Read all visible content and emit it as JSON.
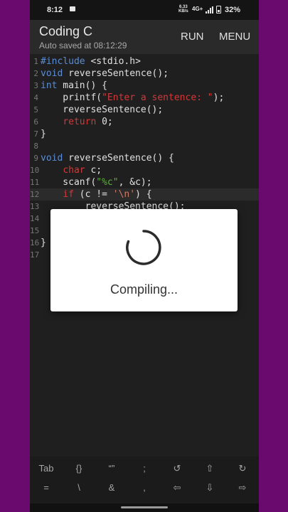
{
  "status_bar": {
    "time": "8:12",
    "speed_value": "6.33",
    "speed_unit": "KB/s",
    "network": "4G+",
    "battery": "32%"
  },
  "header": {
    "title": "Coding C",
    "autosave": "Auto saved at 08:12:29",
    "run_label": "RUN",
    "menu_label": "MENU"
  },
  "editor": {
    "active_line": 12,
    "lines": [
      {
        "n": "1",
        "tokens": [
          {
            "t": "#include",
            "c": "kw-blue"
          },
          {
            "t": " <stdio.h>"
          }
        ]
      },
      {
        "n": "2",
        "tokens": [
          {
            "t": "void",
            "c": "kw-blue"
          },
          {
            "t": " reverseSentence();"
          }
        ]
      },
      {
        "n": "3",
        "tokens": [
          {
            "t": "int",
            "c": "kw-blue"
          },
          {
            "t": " main() {"
          }
        ]
      },
      {
        "n": "4",
        "tokens": [
          {
            "t": "    printf("
          },
          {
            "t": "\"Enter a sentence: \"",
            "c": "kw-red"
          },
          {
            "t": ");"
          }
        ]
      },
      {
        "n": "5",
        "tokens": [
          {
            "t": "    reverseSentence();"
          }
        ]
      },
      {
        "n": "6",
        "tokens": [
          {
            "t": "    "
          },
          {
            "t": "return",
            "c": "kw-red"
          },
          {
            "t": " 0;"
          }
        ]
      },
      {
        "n": "7",
        "tokens": [
          {
            "t": "}"
          }
        ]
      },
      {
        "n": "8",
        "tokens": []
      },
      {
        "n": "9",
        "tokens": [
          {
            "t": "void",
            "c": "kw-blue"
          },
          {
            "t": " reverseSentence() {"
          }
        ]
      },
      {
        "n": "10",
        "tokens": [
          {
            "t": "    "
          },
          {
            "t": "char",
            "c": "kw-red"
          },
          {
            "t": " c;"
          }
        ]
      },
      {
        "n": "11",
        "tokens": [
          {
            "t": "    scanf("
          },
          {
            "t": "\"%c\"",
            "c": "str"
          },
          {
            "t": ", &c);"
          }
        ]
      },
      {
        "n": "12",
        "tokens": [
          {
            "t": "    "
          },
          {
            "t": "if",
            "c": "kw-red"
          },
          {
            "t": " (c != "
          },
          {
            "t": "'\\n'",
            "c": "ch"
          },
          {
            "t": ") {"
          }
        ]
      },
      {
        "n": "13",
        "tokens": [
          {
            "t": "        reverseSentence();"
          }
        ]
      },
      {
        "n": "14",
        "tokens": []
      },
      {
        "n": "15",
        "tokens": []
      },
      {
        "n": "16",
        "tokens": [
          {
            "t": "}"
          }
        ]
      },
      {
        "n": "17",
        "tokens": []
      }
    ]
  },
  "dialog": {
    "message": "Compiling..."
  },
  "keyboard": {
    "row1": [
      "Tab",
      "{}",
      "“”",
      ";",
      "↺",
      "⇧",
      "↻"
    ],
    "row2": [
      "=",
      "\\",
      "&",
      ",",
      "⇦",
      "⇩",
      "⇨"
    ]
  },
  "colors": {
    "background": "#6a0a6e",
    "editor_bg": "#1f1f1f",
    "keyword_blue": "#5b8dd6",
    "keyword_red": "#cf3a3a",
    "string_green": "#5dae3c"
  }
}
